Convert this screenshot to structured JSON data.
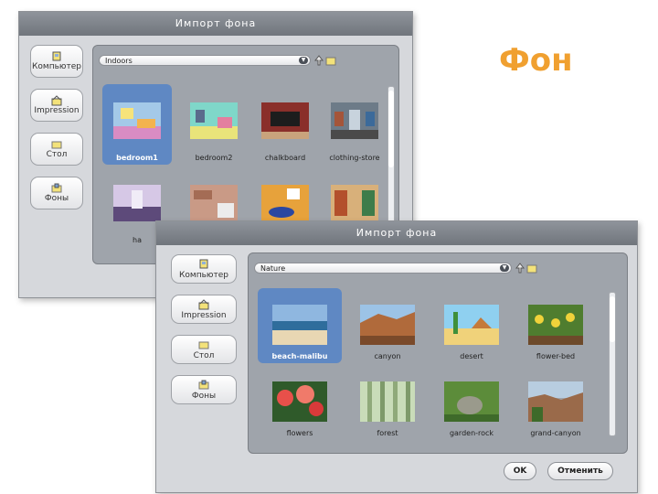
{
  "slide": {
    "heading": "Фон"
  },
  "dialog_back": {
    "title": "Импорт фона",
    "sidebar": [
      "Компьютер",
      "Impression",
      "Стол",
      "Фоны"
    ],
    "path": "Indoors",
    "items": [
      {
        "label": "bedroom1",
        "selected": true
      },
      {
        "label": "bedroom2"
      },
      {
        "label": "chalkboard"
      },
      {
        "label": "clothing-store"
      },
      {
        "label": "ha"
      },
      {
        "label": ""
      },
      {
        "label": ""
      },
      {
        "label": ""
      }
    ]
  },
  "dialog_front": {
    "title": "Импорт фона",
    "sidebar": [
      "Компьютер",
      "Impression",
      "Стол",
      "Фоны"
    ],
    "path": "Nature",
    "items": [
      {
        "label": "beach-malibu",
        "selected": true
      },
      {
        "label": "canyon"
      },
      {
        "label": "desert"
      },
      {
        "label": "flower-bed"
      },
      {
        "label": "flowers"
      },
      {
        "label": "forest"
      },
      {
        "label": "garden-rock"
      },
      {
        "label": "grand-canyon"
      }
    ],
    "ok_label": "OK",
    "cancel_label": "Отменить"
  },
  "colors": {
    "heading": "#f0a030",
    "selection": "#5f88c3",
    "titlebar": "#7f848b"
  }
}
